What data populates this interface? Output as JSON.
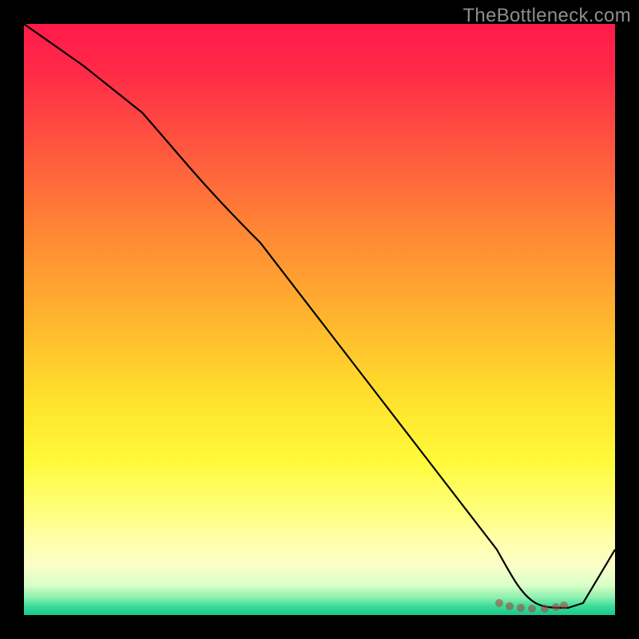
{
  "watermark": "TheBottleneck.com",
  "chart_data": {
    "type": "line",
    "title": "",
    "xlabel": "",
    "ylabel": "",
    "xlim": [
      0,
      100
    ],
    "ylim": [
      0,
      100
    ],
    "series": [
      {
        "name": "bottleneck-curve",
        "x": [
          0,
          10,
          20,
          30,
          40,
          50,
          60,
          70,
          80,
          84,
          88,
          92,
          100
        ],
        "y": [
          100,
          93,
          85,
          76,
          63,
          50,
          37,
          24,
          11,
          3,
          1,
          1,
          11
        ]
      }
    ],
    "markers": {
      "name": "bottleneck-markers",
      "x": [
        80,
        82,
        84,
        86,
        88,
        90,
        91
      ],
      "y": [
        2,
        1.5,
        1.2,
        1.1,
        1.1,
        1.3,
        1.6
      ]
    },
    "gradient_stops": [
      {
        "pos": 0.0,
        "color": "#ff1a4a"
      },
      {
        "pos": 0.22,
        "color": "#ff5a3e"
      },
      {
        "pos": 0.5,
        "color": "#ffb52e"
      },
      {
        "pos": 0.74,
        "color": "#fffa3a"
      },
      {
        "pos": 0.92,
        "color": "#f8ffc8"
      },
      {
        "pos": 1.0,
        "color": "#18c88e"
      }
    ]
  }
}
